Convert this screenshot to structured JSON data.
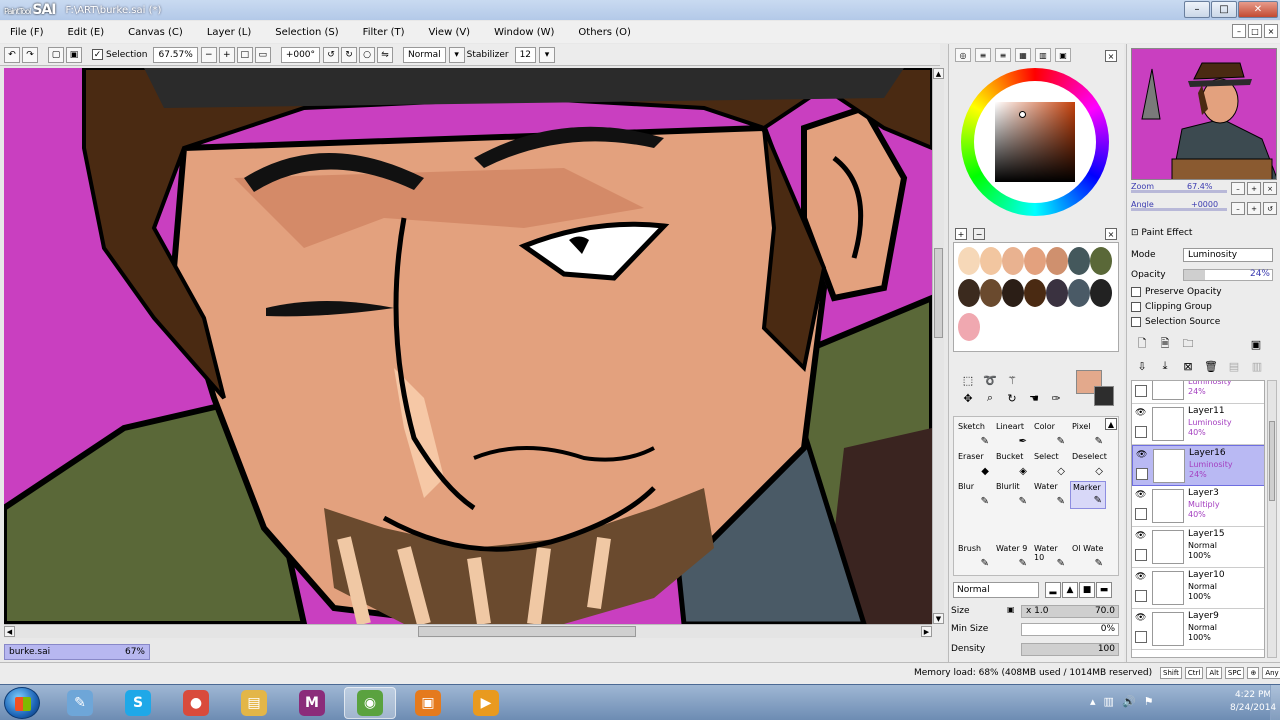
{
  "window": {
    "logo_small": "PaintTool",
    "logo": "SAI",
    "title": "F:\\ART\\burke.sai (*)",
    "min": "–",
    "max": "□",
    "close": "✕"
  },
  "menu": {
    "items": [
      "File (F)",
      "Edit (E)",
      "Canvas (C)",
      "Layer (L)",
      "Selection (S)",
      "Filter (T)",
      "View (V)",
      "Window (W)",
      "Others (O)"
    ],
    "controls": [
      "–",
      "□",
      "×"
    ]
  },
  "toolbar": {
    "selection_label": "Selection",
    "selection_checked": "✓",
    "zoom": "67.57%",
    "angle": "+000°",
    "blend": "Normal",
    "stabilizer_label": "Stabilizer",
    "stabilizer_value": "12"
  },
  "file_tab": {
    "name": "burke.sai",
    "zoom": "67%"
  },
  "navigator": {
    "zoom_label": "Zoom",
    "zoom_value": "67.4%",
    "angle_label": "Angle",
    "angle_value": "+0000",
    "buttons": [
      "–",
      "+",
      "×",
      "–",
      "+",
      "↺"
    ]
  },
  "layer_props": {
    "tab_label": "Paint Effect",
    "mode_label": "Mode",
    "mode_value": "Luminosity",
    "opacity_label": "Opacity",
    "opacity_value": "24%",
    "preserve_opacity": "Preserve Opacity",
    "clipping_group": "Clipping Group",
    "selection_source": "Selection Source"
  },
  "layers": [
    {
      "name": "",
      "mode": "Luminosity",
      "opacity": "24%",
      "selected": false,
      "partial": true
    },
    {
      "name": "Layer11",
      "mode": "Luminosity",
      "opacity": "40%",
      "selected": false
    },
    {
      "name": "Layer16",
      "mode": "Luminosity",
      "opacity": "24%",
      "selected": true
    },
    {
      "name": "Layer3",
      "mode": "Multiply",
      "opacity": "40%",
      "selected": false
    },
    {
      "name": "Layer15",
      "mode": "Normal",
      "opacity": "100%",
      "selected": false
    },
    {
      "name": "Layer10",
      "mode": "Normal",
      "opacity": "100%",
      "selected": false
    },
    {
      "name": "Layer9",
      "mode": "Normal",
      "opacity": "100%",
      "selected": false
    }
  ],
  "tools": [
    {
      "label": "Sketch",
      "icon": "✎"
    },
    {
      "label": "Lineart",
      "icon": "✒"
    },
    {
      "label": "Color",
      "icon": "✎"
    },
    {
      "label": "Pixel",
      "icon": "✎"
    },
    {
      "label": "Eraser",
      "icon": "◆"
    },
    {
      "label": "Bucket",
      "icon": "◈"
    },
    {
      "label": "Select",
      "icon": "◇"
    },
    {
      "label": "Deselect",
      "icon": "◇"
    },
    {
      "label": "Blur",
      "icon": "✎"
    },
    {
      "label": "Blurlit",
      "icon": "✎"
    },
    {
      "label": "Water",
      "icon": "✎"
    },
    {
      "label": "Marker",
      "icon": "✎"
    },
    {
      "label": "Brush",
      "icon": "✎"
    },
    {
      "label": "Water 9",
      "icon": "✎"
    },
    {
      "label": "Water 10",
      "icon": "✎"
    },
    {
      "label": "Ol Wate",
      "icon": "✎"
    }
  ],
  "brush": {
    "mode": "Normal",
    "size_label": "Size",
    "size_mult": "x 1.0",
    "size_value": "70.0",
    "minsize_label": "Min Size",
    "minsize_value": "0%",
    "density_label": "Density",
    "density_value": "100",
    "density_fraction": 1.0
  },
  "status": {
    "memory": "Memory load: 68% (408MB used / 1014MB reserved)",
    "keys": [
      "Shift",
      "Ctrl",
      "Alt",
      "SPC",
      "⊕",
      "Any"
    ]
  },
  "taskbar": {
    "time": "4:22 PM",
    "date": "8/24/2014",
    "apps": [
      {
        "name": "paint-app-icon",
        "icon": "✎",
        "color": "#6ea6d8"
      },
      {
        "name": "skype-icon",
        "icon": "S",
        "color": "#1fa8e8"
      },
      {
        "name": "chrome-icon",
        "icon": "●",
        "color": "#d94b3c"
      },
      {
        "name": "explorer-icon",
        "icon": "▤",
        "color": "#e3b648"
      },
      {
        "name": "mail-app-icon",
        "icon": "M",
        "color": "#8b2c7a"
      },
      {
        "name": "sai-app-icon",
        "icon": "◉",
        "color": "#5aa23f"
      },
      {
        "name": "app-icon",
        "icon": "▣",
        "color": "#e57a1d"
      },
      {
        "name": "media-player-icon",
        "icon": "▶",
        "color": "#e99a1f"
      }
    ]
  },
  "colors": {
    "canvas_bg": "#c93fc0",
    "skin": "#e3a17e",
    "hair": "#4a2a12",
    "jacket": "#5a6838",
    "scarf": "#4a5a66",
    "selection": "#b9b9f3",
    "current_color": "#e3a98c"
  }
}
